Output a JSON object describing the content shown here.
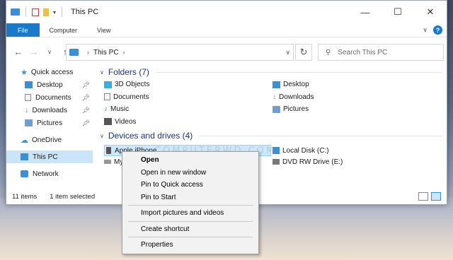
{
  "window": {
    "title": "This PC"
  },
  "ribbon": {
    "tabs": [
      "File",
      "Computer",
      "View"
    ]
  },
  "address": {
    "crumb": "This PC"
  },
  "search": {
    "placeholder": "Search This PC"
  },
  "sidebar": {
    "items": [
      {
        "label": "Quick access",
        "icon": "star-icon",
        "color": "#3a8fd6"
      },
      {
        "label": "Desktop",
        "icon": "desktop-icon",
        "color": "#3a8fd6",
        "pinned": true
      },
      {
        "label": "Documents",
        "icon": "documents-icon",
        "color": "#8a8a8a",
        "pinned": true
      },
      {
        "label": "Downloads",
        "icon": "download-icon",
        "color": "#3a8fd6",
        "pinned": true
      },
      {
        "label": "Pictures",
        "icon": "pictures-icon",
        "color": "#6a9fd6",
        "pinned": true
      },
      {
        "label": "OneDrive",
        "icon": "cloud-icon",
        "color": "#3a8fd6"
      },
      {
        "label": "This PC",
        "icon": "pc-icon",
        "color": "#3a8fd6",
        "selected": true
      },
      {
        "label": "Network",
        "icon": "network-icon",
        "color": "#3a8fd6"
      }
    ]
  },
  "folders": {
    "heading": "Folders (7)",
    "items": [
      "3D Objects",
      "Desktop",
      "Documents",
      "Downloads",
      "Music",
      "Pictures",
      "Videos"
    ]
  },
  "devices": {
    "heading": "Devices and drives (4)",
    "items": [
      "Apple iPhone",
      "Local Disk (C:)",
      "My",
      "DVD RW Drive (E:)"
    ]
  },
  "status": {
    "count": "11 items",
    "selection": "1 item selected"
  },
  "watermark": "COMPUTERWD.COM",
  "context_menu": {
    "items": [
      "Open",
      "Open in new window",
      "Pin to Quick access",
      "Pin to Start",
      "Import pictures and videos",
      "Create shortcut",
      "Properties"
    ]
  },
  "colors": {
    "accent": "#1979ca",
    "selection": "#cce8ff",
    "heading": "#1e3287"
  }
}
